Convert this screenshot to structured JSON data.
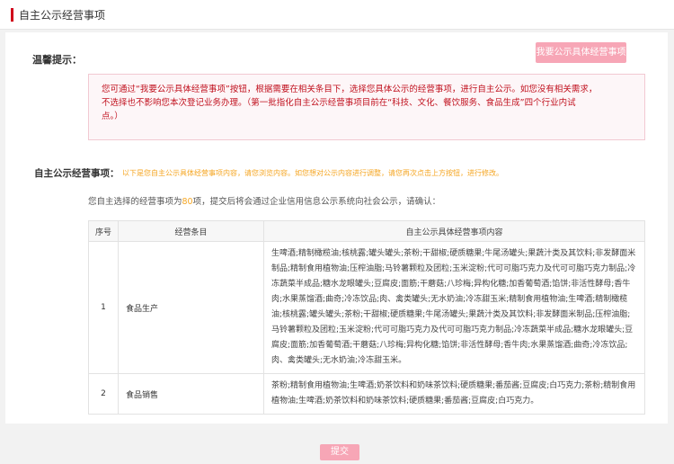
{
  "header": {
    "title": "自主公示经营事项"
  },
  "tips": {
    "label": "温馨提示：",
    "button_label": "我要公示具体经营事项",
    "notice_line1": "您可通过“我要公示具体经营事项”按钮，根据需要在相关条目下，选择您具体公示的经营事项，进行自主公示。如您没有相关需求，",
    "notice_line2": "不选择也不影响您本次登记业务办理。（第一批指化自主公示经营事项目前在“科技、文化、餐饮服务、食品生成”四个行业内试",
    "notice_line3": "点。）"
  },
  "section": {
    "label": "自主公示经营事项：",
    "note": "以下是您自主公示具体经营事项内容，请您浏览内容。如您想对公示内容进行调整，请您再次点击上方按钮，进行修改。"
  },
  "summary": {
    "prefix": "您自主选择的经营事项为",
    "count": "80",
    "suffix": "项，提交后将会通过企业信用信息公示系统向社会公示，请确认："
  },
  "table": {
    "headers": [
      "序号",
      "经营条目",
      "自主公示具体经营事项内容"
    ],
    "rows": [
      {
        "no": "1",
        "category": "食品生产",
        "content": "生啤酒;精制橄榄油;核桃露;罐头罐头;茶粉;干甜椒;硬质糖果;牛尾汤罐头;果蔬汁类及其饮料;非发酵面米制品;精制食用植物油;压榨油脂;马铃薯颗粒及团粒;玉米淀粉;代可可脂巧克力及代可可脂巧克力制品;冷冻蔬菜半成品;糖水龙眼罐头;豆腐皮;面筋;干蘑菇;八珍梅;异构化糖;加香葡萄酒;馅饼;非活性酵母;香牛肉;水果蒸馏酒;曲奇;冷冻饮品;肉、禽类罐头;无水奶油;冷冻甜玉米;精制食用植物油;生啤酒;精制橄榄油;核桃露;罐头罐头;茶粉;干甜椒;硬质糖果;牛尾汤罐头;果蔬汁类及其饮料;非发酵面米制品;压榨油脂;马铃薯颗粒及团粒;玉米淀粉;代可可脂巧克力及代可可脂巧克力制品;冷冻蔬菜半成品;糖水龙眼罐头;豆腐皮;面筋;加香葡萄酒;干蘑菇;八珍梅;异构化糖;馅饼;非活性酵母;香牛肉;水果蒸馏酒;曲奇;冷冻饮品;肉、禽类罐头;无水奶油;冷冻甜玉米。"
      },
      {
        "no": "2",
        "category": "食品销售",
        "content": "茶粉;精制食用植物油;生啤酒;奶茶饮料和奶味茶饮料;硬质糖果;番茄酱;豆腐皮;白巧克力;茶粉;精制食用植物油;生啤酒;奶茶饮料和奶味茶饮料;硬质糖果;番茄酱;豆腐皮;白巧克力。"
      }
    ]
  },
  "submit_label": "提交"
}
